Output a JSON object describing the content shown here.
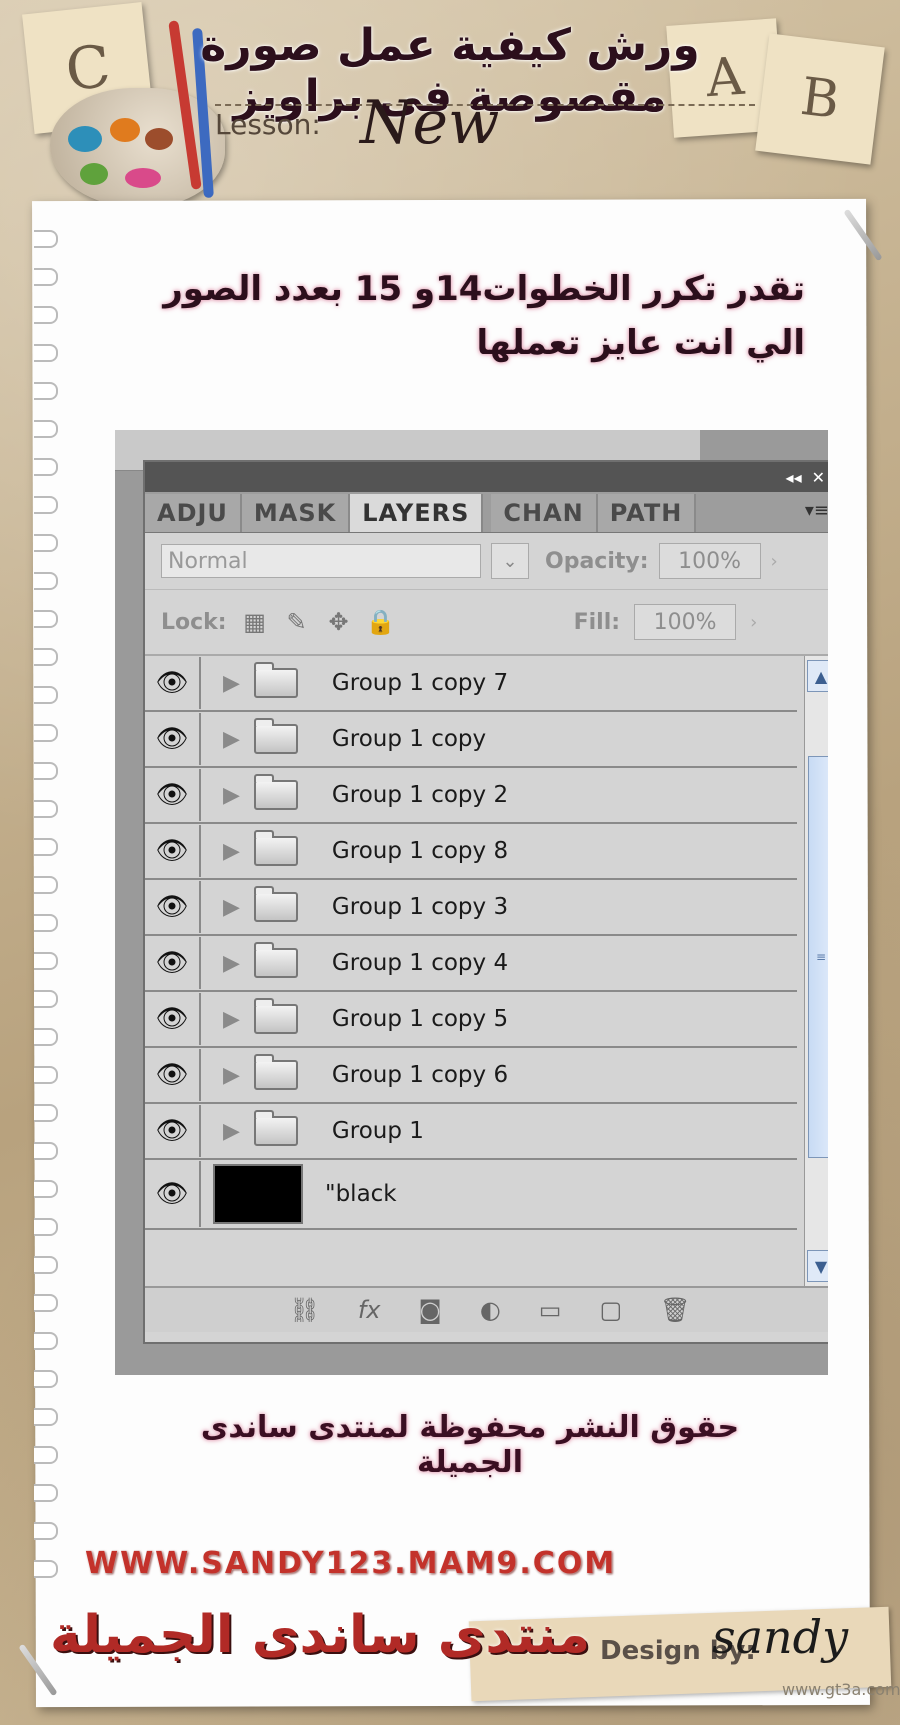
{
  "header": {
    "title_ar": "ورش كيفية عمل صورة مقصوصة فى براويز",
    "lesson_label": "Lesson:",
    "lesson_title": "New",
    "tile_c": "C",
    "tile_a": "A",
    "tile_b": "B"
  },
  "content": {
    "instruction_ar": "تقدر تكرر الخطوات14و 15 بعدد الصور الي انت عايز تعملها",
    "copyright_ar": "حقوق النشر محفوظة لمنتدى ساندى الجميلة"
  },
  "photoshop": {
    "tabs": [
      "ADJU",
      "MASK",
      "LAYERS",
      "CHAN",
      "PATH"
    ],
    "active_tab": "LAYERS",
    "collapse_icon": "◂◂",
    "close_icon": "✕",
    "menu_icon": "▾≡",
    "blend_mode": "Normal",
    "opacity_label": "Opacity:",
    "opacity_value": "100%",
    "lock_label": "Lock:",
    "fill_label": "Fill:",
    "fill_value": "100%",
    "layers": [
      {
        "name": "Group 1 copy 7",
        "type": "group"
      },
      {
        "name": "Group 1 copy",
        "type": "group"
      },
      {
        "name": "Group 1 copy 2",
        "type": "group"
      },
      {
        "name": "Group 1 copy 8",
        "type": "group"
      },
      {
        "name": "Group 1 copy 3",
        "type": "group"
      },
      {
        "name": "Group 1 copy 4",
        "type": "group"
      },
      {
        "name": "Group 1 copy 5",
        "type": "group"
      },
      {
        "name": "Group 1 copy 6",
        "type": "group"
      },
      {
        "name": "Group 1",
        "type": "group"
      },
      {
        "name": "\"black",
        "type": "fill"
      }
    ],
    "bottom_icons": [
      "link-icon",
      "fx-icon",
      "mask-icon",
      "adjustment-icon",
      "new-group-icon",
      "new-layer-icon",
      "trash-icon"
    ],
    "fx_label": "fx"
  },
  "footer": {
    "url": "WWW.SANDY123.MAM9.COM",
    "forum_name_ar": "منتدى ساندى الجميلة",
    "design_by": "Design by:",
    "signature": "sandy",
    "watermark": "www.gt3a.com"
  }
}
